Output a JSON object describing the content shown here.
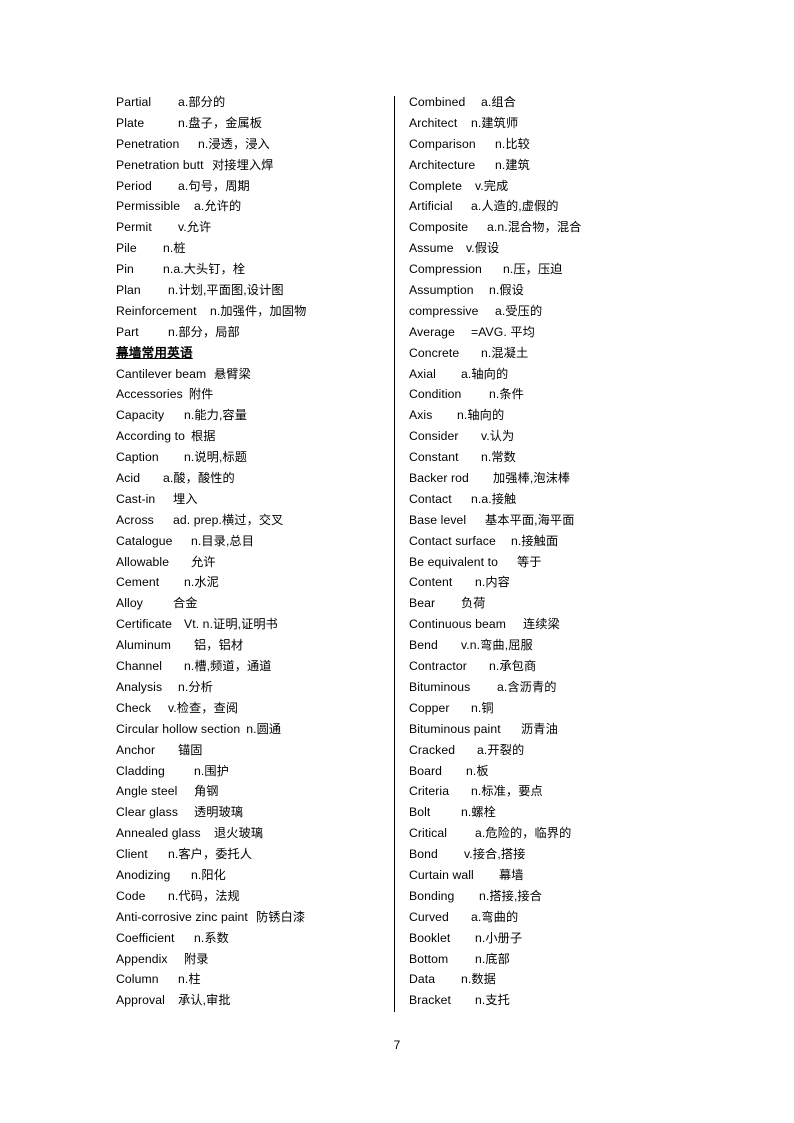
{
  "page": {
    "number": "7",
    "heading": "幕墙常用英语"
  },
  "left_column": {
    "entries": [
      {
        "term": "Partial",
        "indent": 62,
        "gloss": "a.部分的"
      },
      {
        "term": "Plate",
        "indent": 62,
        "gloss": "n.盘子，金属板"
      },
      {
        "term": "Penetration",
        "indent": 82,
        "gloss": "n.浸透，浸入"
      },
      {
        "term": "Penetration butt",
        "indent": 96,
        "gloss": "对接埋入焊"
      },
      {
        "term": "Period",
        "indent": 62,
        "gloss": "a.句号，周期"
      },
      {
        "term": "Permissible",
        "indent": 78,
        "gloss": "a.允许的"
      },
      {
        "term": "Permit",
        "indent": 62,
        "gloss": "v.允许"
      },
      {
        "term": "Pile",
        "indent": 47,
        "gloss": "n.桩"
      },
      {
        "term": "Pin",
        "indent": 47,
        "gloss": "n.a.大头钉，栓"
      },
      {
        "term": "Plan",
        "indent": 52,
        "gloss": "n.计划,平面图,设计图"
      },
      {
        "term": "Reinforcement",
        "indent": 94,
        "gloss": "n.加强件，加固物"
      },
      {
        "term": "Part",
        "indent": 52,
        "gloss": "n.部分，局部"
      },
      {
        "heading": "幕墙常用英语"
      },
      {
        "term": "Cantilever beam",
        "indent": 98,
        "gloss": "悬臂梁"
      },
      {
        "term": "Accessories",
        "indent": 68,
        "gloss": "附件"
      },
      {
        "term": "Capacity",
        "indent": 68,
        "gloss": "n.能力,容量"
      },
      {
        "term": "According to",
        "indent": 62,
        "gloss": "根据"
      },
      {
        "term": "Caption",
        "indent": 68,
        "gloss": "n.说明,标题"
      },
      {
        "term": "Acid",
        "indent": 47,
        "gloss": "a.酸，酸性的"
      },
      {
        "term": "Cast-in",
        "indent": 57,
        "gloss": "埋入"
      },
      {
        "term": "Across",
        "indent": 57,
        "gloss": "ad. prep.横过，交叉"
      },
      {
        "term": "Catalogue",
        "indent": 75,
        "gloss": "n.目录,总目"
      },
      {
        "term": "Allowable",
        "indent": 75,
        "gloss": "允许"
      },
      {
        "term": "Cement",
        "indent": 68,
        "gloss": "n.水泥"
      },
      {
        "term": "Alloy",
        "indent": 57,
        "gloss": "合金"
      },
      {
        "term": "Certificate",
        "indent": 68,
        "gloss": "Vt. n.证明,证明书"
      },
      {
        "term": "Aluminum",
        "indent": 78,
        "gloss": "铝，铝材"
      },
      {
        "term": "Channel",
        "indent": 68,
        "gloss": "n.槽,频道，通道"
      },
      {
        "term": "Analysis",
        "indent": 62,
        "gloss": "n.分析"
      },
      {
        "term": "Check",
        "indent": 52,
        "gloss": "v.检查，查阅"
      },
      {
        "term": "Circular hollow section",
        "indent": 126,
        "gloss": "n.圆通"
      },
      {
        "term": "Anchor",
        "indent": 62,
        "gloss": "锚固"
      },
      {
        "term": "Cladding",
        "indent": 78,
        "gloss": "n.围护"
      },
      {
        "term": "Angle steel",
        "indent": 78,
        "gloss": "角钢"
      },
      {
        "term": "Clear glass",
        "indent": 78,
        "gloss": "透明玻璃"
      },
      {
        "term": "Annealed glass",
        "indent": 98,
        "gloss": "退火玻璃"
      },
      {
        "term": "Client",
        "indent": 52,
        "gloss": "n.客户，委托人"
      },
      {
        "term": "Anodizing",
        "indent": 75,
        "gloss": "n.阳化"
      },
      {
        "term": "Code",
        "indent": 52,
        "gloss": "n.代码，法规"
      },
      {
        "term": "Anti-corrosive zinc paint",
        "indent": 140,
        "gloss": "防锈白漆"
      },
      {
        "term": "Coefficient",
        "indent": 78,
        "gloss": "n.系数"
      },
      {
        "term": "Appendix",
        "indent": 68,
        "gloss": "附录"
      },
      {
        "term": "Column",
        "indent": 62,
        "gloss": "n.柱"
      },
      {
        "term": "Approval",
        "indent": 62,
        "gloss": "承认,审批"
      }
    ]
  },
  "right_column": {
    "entries": [
      {
        "term": "Combined",
        "indent": 72,
        "gloss": "a.组合"
      },
      {
        "term": "Architect",
        "indent": 62,
        "gloss": "n.建筑师"
      },
      {
        "term": "Comparison",
        "indent": 86,
        "gloss": "n.比较"
      },
      {
        "term": "Architecture",
        "indent": 86,
        "gloss": "n.建筑"
      },
      {
        "term": "Complete",
        "indent": 66,
        "gloss": "v.完成"
      },
      {
        "term": "Artificial",
        "indent": 62,
        "gloss": "a.人造的,虚假的"
      },
      {
        "term": "Composite",
        "indent": 78,
        "gloss": "a.n.混合物，混合"
      },
      {
        "term": "Assume",
        "indent": 57,
        "gloss": "v.假设"
      },
      {
        "term": "Compression",
        "indent": 94,
        "gloss": "n.压，压迫"
      },
      {
        "term": "Assumption",
        "indent": 80,
        "gloss": "n.假设"
      },
      {
        "term": "compressive",
        "indent": 86,
        "gloss": "a.受压的"
      },
      {
        "term": "Average",
        "indent": 62,
        "gloss": "=AVG. 平均"
      },
      {
        "term": "Concrete",
        "indent": 72,
        "gloss": "n.混凝土"
      },
      {
        "term": "Axial",
        "indent": 52,
        "gloss": "a.轴向的"
      },
      {
        "term": "Condition",
        "indent": 80,
        "gloss": "n.条件"
      },
      {
        "term": "Axis",
        "indent": 48,
        "gloss": "n.轴向的"
      },
      {
        "term": "Consider",
        "indent": 72,
        "gloss": "v.认为"
      },
      {
        "term": "Constant",
        "indent": 72,
        "gloss": "n.常数"
      },
      {
        "term": "Backer rod",
        "indent": 84,
        "gloss": "加强棒,泡沫棒"
      },
      {
        "term": "Contact",
        "indent": 62,
        "gloss": "n.a.接触"
      },
      {
        "term": "Base level",
        "indent": 76,
        "gloss": "基本平面,海平面"
      },
      {
        "term": "Contact surface",
        "indent": 102,
        "gloss": "n.接触面"
      },
      {
        "term": "Be equivalent to",
        "indent": 108,
        "gloss": "等于"
      },
      {
        "term": "Content",
        "indent": 66,
        "gloss": "n.内容"
      },
      {
        "term": "Bear",
        "indent": 52,
        "gloss": "负荷"
      },
      {
        "term": "Continuous beam",
        "indent": 114,
        "gloss": "连续梁"
      },
      {
        "term": "Bend",
        "indent": 52,
        "gloss": "v.n.弯曲,屈服"
      },
      {
        "term": "Contractor",
        "indent": 80,
        "gloss": "n.承包商"
      },
      {
        "term": "Bituminous",
        "indent": 88,
        "gloss": "a.含沥青的"
      },
      {
        "term": "Copper",
        "indent": 62,
        "gloss": "n.铜"
      },
      {
        "term": "Bituminous paint",
        "indent": 112,
        "gloss": "沥青油"
      },
      {
        "term": "Cracked",
        "indent": 68,
        "gloss": "a.开裂的"
      },
      {
        "term": "Board",
        "indent": 57,
        "gloss": "n.板"
      },
      {
        "term": "Criteria",
        "indent": 62,
        "gloss": "n.标准，要点"
      },
      {
        "term": "Bolt",
        "indent": 52,
        "gloss": "n.螺栓"
      },
      {
        "term": "Critical",
        "indent": 66,
        "gloss": "a.危险的，临界的"
      },
      {
        "term": "Bond",
        "indent": 55,
        "gloss": "v.接合,搭接"
      },
      {
        "term": "Curtain wall",
        "indent": 90,
        "gloss": "幕墙"
      },
      {
        "term": "Bonding",
        "indent": 70,
        "gloss": "n.搭接,接合"
      },
      {
        "term": "Curved",
        "indent": 62,
        "gloss": "a.弯曲的"
      },
      {
        "term": "Booklet",
        "indent": 66,
        "gloss": "n.小册子"
      },
      {
        "term": "Bottom",
        "indent": 66,
        "gloss": "n.底部"
      },
      {
        "term": "Data",
        "indent": 52,
        "gloss": "n.数据"
      },
      {
        "term": "Bracket",
        "indent": 66,
        "gloss": "n.支托"
      }
    ]
  }
}
